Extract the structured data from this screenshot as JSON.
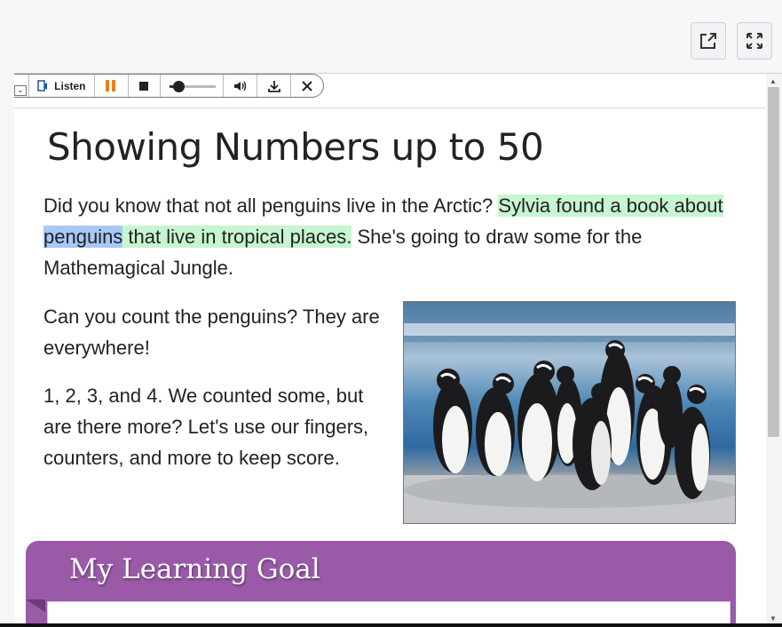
{
  "toolbar": {
    "listen_label": "Listen",
    "volume_level": 0.2
  },
  "page": {
    "title": "Showing Numbers up to 50",
    "para1": {
      "before": "Did you know that not all penguins live in the Arctic? ",
      "hl_before": "Sylvia found a book about ",
      "hl_word": "penguins",
      "hl_after": " that live in tropical places.",
      "after": " She's going to draw some for the Mathemagical Jungle."
    },
    "para2": "Can you count the penguins? They are everywhere!",
    "para3": "1, 2, 3, and 4. We counted some, but are there more? Let's use our fingers, counters, and more to keep score.",
    "goal_title": "My Learning Goal"
  },
  "colors": {
    "sentence_highlight": "#c6f5cf",
    "word_highlight": "#a9c8f7",
    "goal_banner": "#9a5aa8",
    "pause_icon": "#e8821e"
  }
}
